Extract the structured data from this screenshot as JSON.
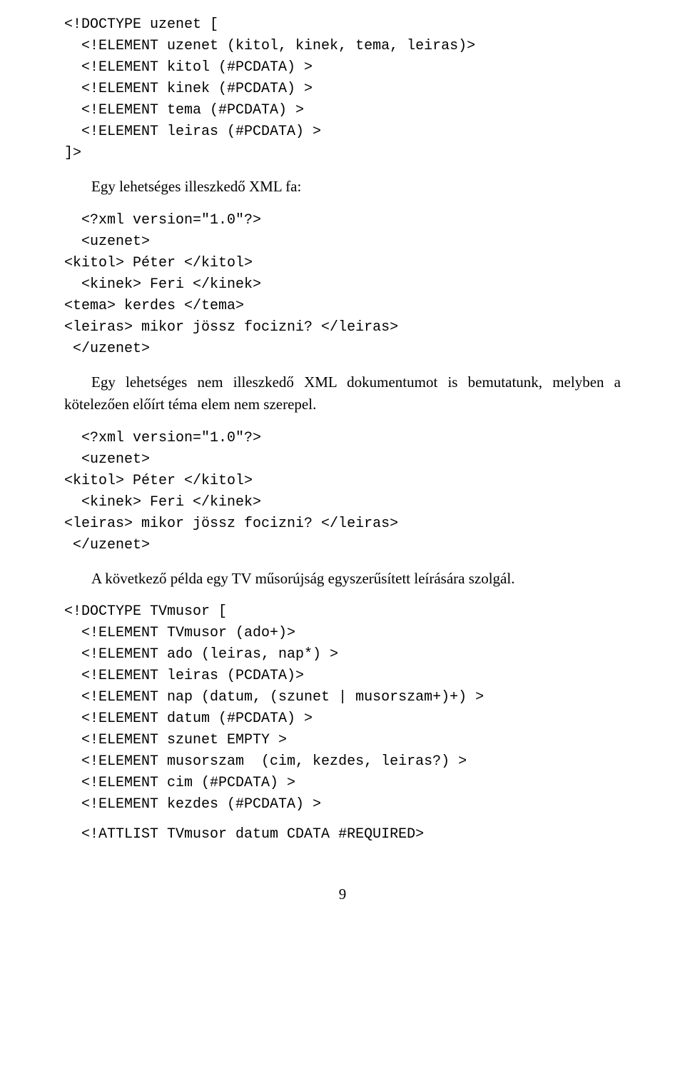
{
  "code1": "<!DOCTYPE uzenet [\n  <!ELEMENT uzenet (kitol, kinek, tema, leiras)>\n  <!ELEMENT kitol (#PCDATA) >\n  <!ELEMENT kinek (#PCDATA) >\n  <!ELEMENT tema (#PCDATA) >\n  <!ELEMENT leiras (#PCDATA) >\n]>",
  "para1": "Egy lehetséges illeszkedő XML fa:",
  "code2": "  <?xml version=\"1.0\"?>\n  <uzenet>\n<kitol> Péter </kitol>\n  <kinek> Feri </kinek>\n<tema> kerdes </tema>\n<leiras> mikor jössz focizni? </leiras>\n </uzenet>",
  "para2": "Egy lehetséges nem illeszkedő XML dokumentumot is bemutatunk, melyben a kötelezően előírt téma elem nem szerepel.",
  "code3": "  <?xml version=\"1.0\"?>\n  <uzenet>\n<kitol> Péter </kitol>\n  <kinek> Feri </kinek>\n<leiras> mikor jössz focizni? </leiras>\n </uzenet>",
  "para3": "A következő példa egy TV műsorújság egyszerűsített leírására szolgál.",
  "code4": "<!DOCTYPE TVmusor [\n  <!ELEMENT TVmusor (ado+)>\n  <!ELEMENT ado (leiras, nap*) >\n  <!ELEMENT leiras (PCDATA)>\n  <!ELEMENT nap (datum, (szunet | musorszam+)+) >\n  <!ELEMENT datum (#PCDATA) >\n  <!ELEMENT szunet EMPTY >\n  <!ELEMENT musorszam  (cim, kezdes, leiras?) >\n  <!ELEMENT cim (#PCDATA) >\n  <!ELEMENT kezdes (#PCDATA) >",
  "code5": "  <!ATTLIST TVmusor datum CDATA #REQUIRED>",
  "pagenum": "9"
}
